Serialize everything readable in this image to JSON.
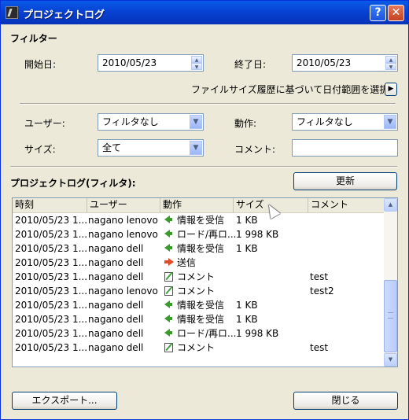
{
  "window": {
    "title": "プロジェクトログ",
    "help": "?",
    "close": "✕"
  },
  "filter": {
    "title": "フィルター",
    "start_label": "開始日:",
    "start_value": "2010/05/23",
    "end_label": "終了日:",
    "end_value": "2010/05/23",
    "range_hint": "ファイルサイズ履歴に基づいて日付範囲を選択",
    "user_label": "ユーザー:",
    "user_value": "フィルタなし",
    "action_label": "動作:",
    "action_value": "フィルタなし",
    "size_label": "サイズ:",
    "size_value": "全て",
    "comment_label": "コメント:",
    "comment_value": ""
  },
  "log": {
    "title": "プロジェクトログ(フィルタ):",
    "refresh": "更新",
    "columns": [
      "時刻",
      "ユーザー",
      "動作",
      "サイズ",
      "コメント"
    ],
    "rows": [
      {
        "time": "2010/05/23 1...",
        "user": "nagano lenovo",
        "icon": "receive-icon",
        "action": "情報を受信",
        "size": "1 KB",
        "comment": ""
      },
      {
        "time": "2010/05/23 1...",
        "user": "nagano lenovo",
        "icon": "receive-icon",
        "action": "ロード/再ロ...",
        "size": "1 998 KB",
        "comment": ""
      },
      {
        "time": "2010/05/23 1...",
        "user": "nagano dell",
        "icon": "receive-icon",
        "action": "情報を受信",
        "size": "1 KB",
        "comment": ""
      },
      {
        "time": "2010/05/23 1...",
        "user": "nagano dell",
        "icon": "send-icon",
        "action": "送信",
        "size": "",
        "comment": ""
      },
      {
        "time": "2010/05/23 1...",
        "user": "nagano dell",
        "icon": "comment-icon",
        "action": "コメント",
        "size": "",
        "comment": "test"
      },
      {
        "time": "2010/05/23 1...",
        "user": "nagano lenovo",
        "icon": "comment-icon",
        "action": "コメント",
        "size": "",
        "comment": "test2"
      },
      {
        "time": "2010/05/23 1...",
        "user": "nagano dell",
        "icon": "receive-icon",
        "action": "情報を受信",
        "size": "1 KB",
        "comment": ""
      },
      {
        "time": "2010/05/23 1...",
        "user": "nagano dell",
        "icon": "receive-icon",
        "action": "情報を受信",
        "size": "1 KB",
        "comment": ""
      },
      {
        "time": "2010/05/23 1...",
        "user": "nagano dell",
        "icon": "receive-icon",
        "action": "ロード/再ロ...",
        "size": "1 998 KB",
        "comment": ""
      },
      {
        "time": "2010/05/23 1...",
        "user": "nagano dell",
        "icon": "comment-icon",
        "action": "コメント",
        "size": "",
        "comment": "test"
      }
    ]
  },
  "footer": {
    "export": "エクスポート...",
    "close": "閉じる"
  }
}
